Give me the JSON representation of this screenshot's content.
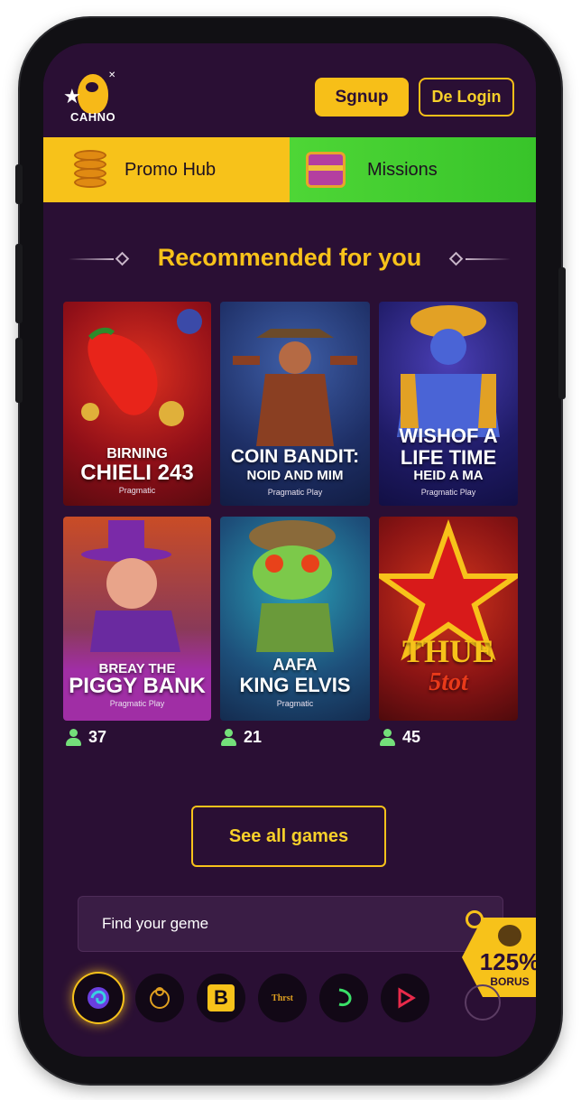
{
  "header": {
    "logo_text": "CAHNO",
    "signup_label": "Sgnup",
    "login_label": "De Login"
  },
  "tabs": [
    {
      "label": "Promo Hub",
      "icon": "coins-icon"
    },
    {
      "label": "Missions",
      "icon": "treasure-chest-icon"
    }
  ],
  "section": {
    "title": "Recommended for you"
  },
  "games": [
    {
      "line1": "BIRNING",
      "line2": "CHIELI 243",
      "sub": "Pragmatic"
    },
    {
      "line1": "COIN BANDIT:",
      "line2": "NOID AND MIM",
      "sub": "Pragmatic Play"
    },
    {
      "line1": "WISHOF A",
      "line2": "LIFE TIME",
      "line3": "HEID A MA",
      "sub": "Pragmatic Play"
    },
    {
      "line1": "BREAY THE",
      "line2": "PIGGY BANK",
      "sub": "Pragmatic Play"
    },
    {
      "line1": "AAFA",
      "line2": "KING ELVIS",
      "sub": "Pragmatic"
    },
    {
      "line1": "THUE",
      "line2": "5tot"
    }
  ],
  "players": [
    "37",
    "21",
    "45"
  ],
  "see_all_label": "See all games",
  "search": {
    "placeholder": "Find your geme"
  },
  "bonus": {
    "percent": "125%",
    "label": "BORUS"
  },
  "providers": [
    {
      "icon": "swirl-provider-icon"
    },
    {
      "icon": "monkey-provider-icon"
    },
    {
      "icon": "b-provider-icon",
      "text": "B"
    },
    {
      "icon": "thrust-provider-icon",
      "text": "Thrst"
    },
    {
      "icon": "green-curve-provider-icon"
    },
    {
      "icon": "play-triangle-provider-icon"
    }
  ],
  "colors": {
    "background": "#2a0f34",
    "accent_yellow": "#f7c21a",
    "missions_green": "#43cc2f"
  }
}
